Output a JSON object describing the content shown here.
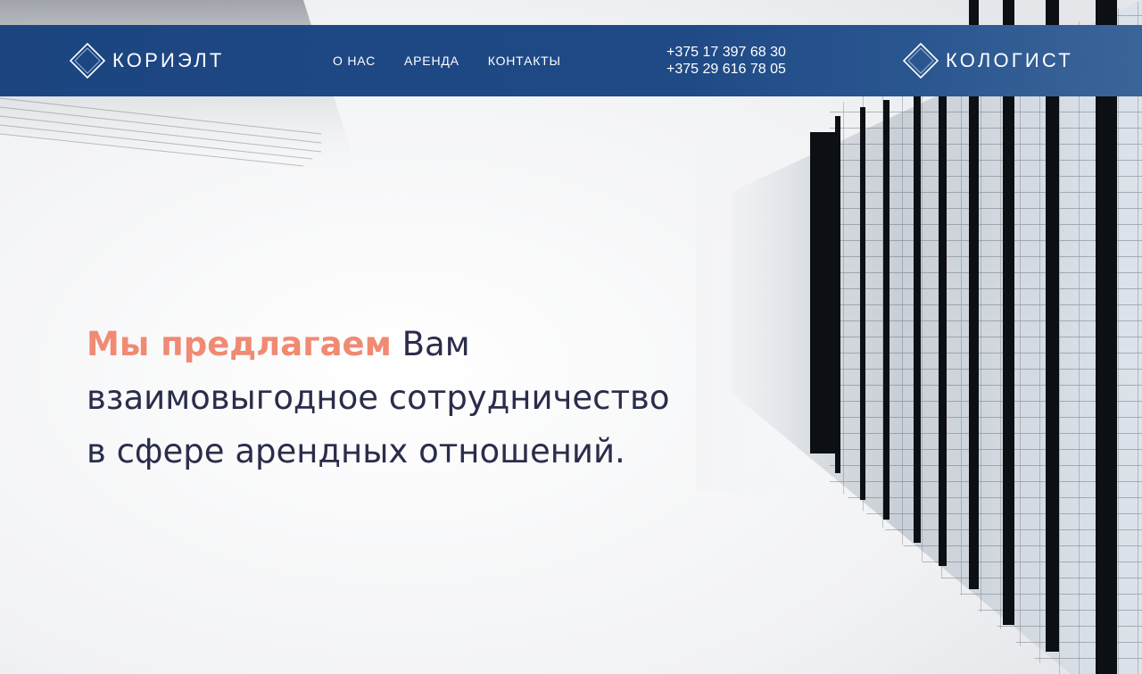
{
  "header": {
    "logo_left": {
      "text": "КОРИЭЛТ",
      "icon": "diamond-logo-icon"
    },
    "logo_right": {
      "text": "КОЛОГИСТ",
      "icon": "diamond-logo-icon"
    },
    "nav": [
      {
        "label": "О НАС"
      },
      {
        "label": "АРЕНДА"
      },
      {
        "label": "КОНТАКТЫ"
      }
    ],
    "phones": [
      "+375 17 397 68 30",
      "+375 29 616 78 05"
    ]
  },
  "hero": {
    "headline_accent": "Мы предлагаем",
    "headline_rest": "Вам",
    "headline_line2": "взаимовыгодное сотрудничество",
    "headline_line3": "в сфере арендных отношений."
  },
  "colors": {
    "header_bg": "#1c4580",
    "accent": "#f08a72",
    "headline_text": "#2a2d4a"
  }
}
